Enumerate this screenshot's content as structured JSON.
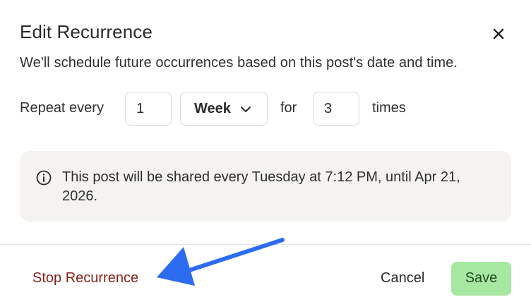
{
  "dialog": {
    "title": "Edit Recurrence",
    "close_icon": "close-icon",
    "description": "We'll schedule future occurrences based on this post's date and time."
  },
  "repeat": {
    "label_repeat_every": "Repeat every",
    "interval_value": "1",
    "unit_selected": "Week",
    "label_for": "for",
    "count_value": "3",
    "label_times": "times"
  },
  "info": {
    "icon": "info-icon",
    "text": "This post will be shared every Tuesday at 7:12 PM, until Apr 21, 2026."
  },
  "footer": {
    "stop_label": "Stop Recurrence",
    "cancel_label": "Cancel",
    "save_label": "Save"
  },
  "colors": {
    "stop": "#8a1e16",
    "save_bg": "#a6e7a2",
    "info_bg": "#f4f3ef",
    "annotation_arrow": "#2d6cf0"
  }
}
